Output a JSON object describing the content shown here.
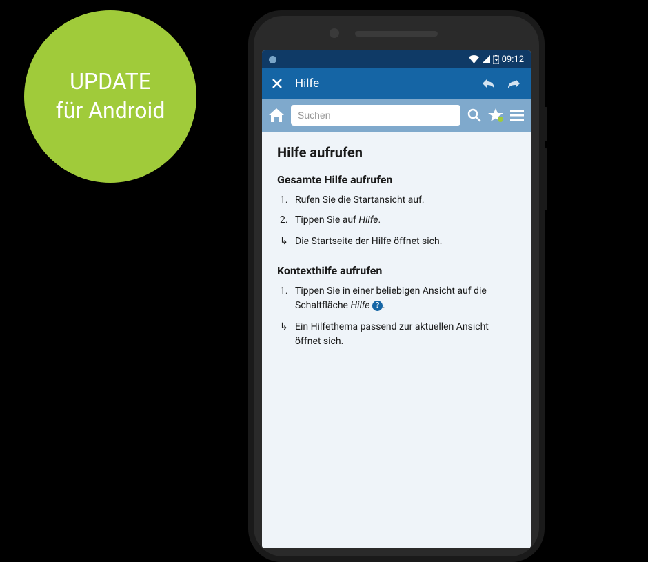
{
  "badge": {
    "line1": "UPDATE",
    "line2": "für Android"
  },
  "colors": {
    "badge_bg": "#a0cb3a",
    "status_bar": "#0f3a66",
    "app_bar": "#1565a5",
    "toolbar": "#7fa9cc",
    "content_bg": "#eff4f9"
  },
  "status_bar": {
    "time": "09:12"
  },
  "app_bar": {
    "title": "Hilfe"
  },
  "toolbar": {
    "search_placeholder": "Suchen"
  },
  "content": {
    "title": "Hilfe aufrufen",
    "section1": {
      "heading": "Gesamte Hilfe aufrufen",
      "steps": [
        {
          "num": "1.",
          "text_before": "Rufen Sie die Startansicht auf.",
          "italic": "",
          "text_after": ""
        },
        {
          "num": "2.",
          "text_before": "Tippen Sie auf ",
          "italic": "Hilfe",
          "text_after": "."
        }
      ],
      "result": {
        "arrow": "↳",
        "text": "Die Startseite der Hilfe öffnet sich."
      }
    },
    "section2": {
      "heading": "Kontexthilfe aufrufen",
      "steps": [
        {
          "num": "1.",
          "text_before": "Tippen Sie in einer beliebigen Ansicht auf die Schaltfläche ",
          "italic": "Hilfe",
          "text_after": " ",
          "badge": "?"
        }
      ],
      "result": {
        "arrow": "↳",
        "text": "Ein Hilfethema passend zur aktuellen Ansicht öffnet sich."
      }
    }
  }
}
